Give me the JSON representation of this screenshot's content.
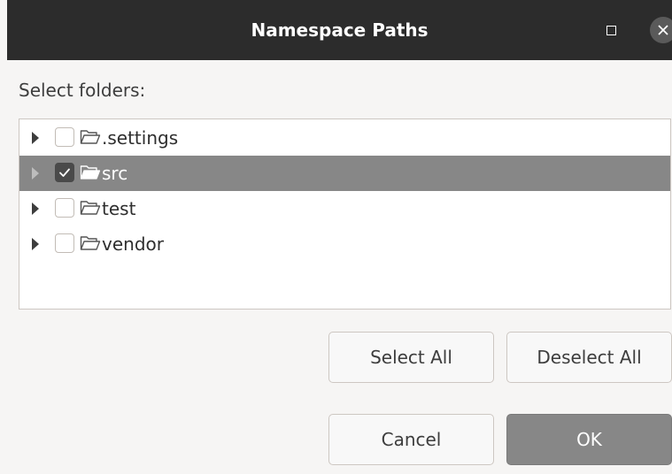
{
  "window": {
    "title": "Namespace Paths"
  },
  "prompt": "Select folders:",
  "folders": [
    {
      "label": ".settings",
      "checked": false,
      "selected": false
    },
    {
      "label": "src",
      "checked": true,
      "selected": true
    },
    {
      "label": "test",
      "checked": false,
      "selected": false
    },
    {
      "label": "vendor",
      "checked": false,
      "selected": false
    }
  ],
  "buttons": {
    "select_all": "Select All",
    "deselect_all": "Deselect All",
    "cancel": "Cancel",
    "ok": "OK"
  },
  "icons": {
    "expander": "triangle-right-icon",
    "folder": "folder-open-icon",
    "maximize": "maximize-icon",
    "close": "close-icon"
  },
  "colors": {
    "titlebar": "#2c2c2c",
    "selection": "#878787",
    "primary_button": "#878787"
  }
}
